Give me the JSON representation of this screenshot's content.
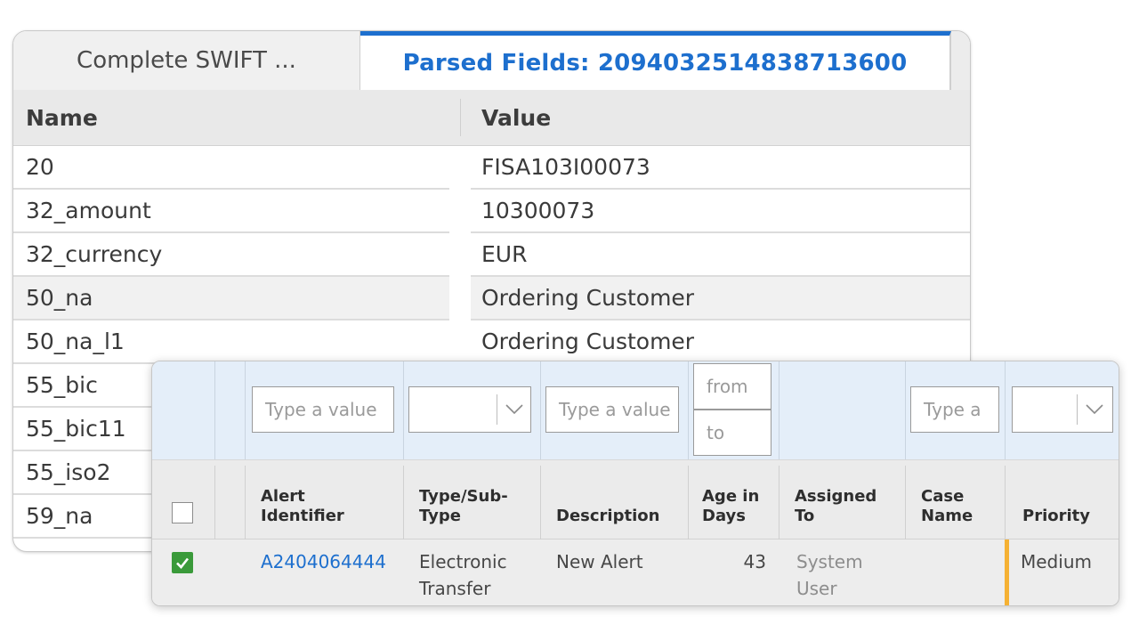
{
  "tabs": {
    "complete_swift": "Complete SWIFT ...",
    "parsed_fields": "Parsed Fields: 2094032514838713600"
  },
  "fields_grid": {
    "columns": {
      "name": "Name",
      "value": "Value"
    },
    "rows": [
      {
        "name": "20",
        "value": "FISA103I00073"
      },
      {
        "name": "32_amount",
        "value": "10300073"
      },
      {
        "name": "32_currency",
        "value": "EUR"
      },
      {
        "name": "50_na",
        "value": "Ordering Customer"
      },
      {
        "name": "50_na_l1",
        "value": "Ordering Customer"
      },
      {
        "name": "55_bic",
        "value": ""
      },
      {
        "name": "55_bic11",
        "value": ""
      },
      {
        "name": "55_iso2",
        "value": ""
      },
      {
        "name": "59_na",
        "value": ""
      }
    ]
  },
  "alerts_grid": {
    "filters": {
      "alert_identifier_placeholder": "Type a value",
      "description_placeholder": "Type a value",
      "age_from_placeholder": "from",
      "age_to_placeholder": "to",
      "case_name_placeholder": "Type a"
    },
    "columns": {
      "alert_identifier": "Alert\nIdentifier",
      "type_subtype": "Type/Sub-\nType",
      "description": "Description",
      "age_in_days": "Age in\nDays",
      "assigned_to": "Assigned\nTo",
      "case_name": "Case\nName",
      "priority": "Priority"
    },
    "rows": [
      {
        "selected": true,
        "alert_identifier": "A2404064444",
        "type_subtype": "Electronic\nTransfer",
        "description": "New Alert",
        "age_in_days": "43",
        "assigned_to": "System\nUser",
        "case_name": "",
        "priority": "Medium"
      }
    ]
  },
  "colors": {
    "accent": "#1d6fce",
    "checkbox_checked": "#3a9a3a",
    "priority_medium": "#f5b133",
    "filter_row_bg": "#e4eef9"
  }
}
